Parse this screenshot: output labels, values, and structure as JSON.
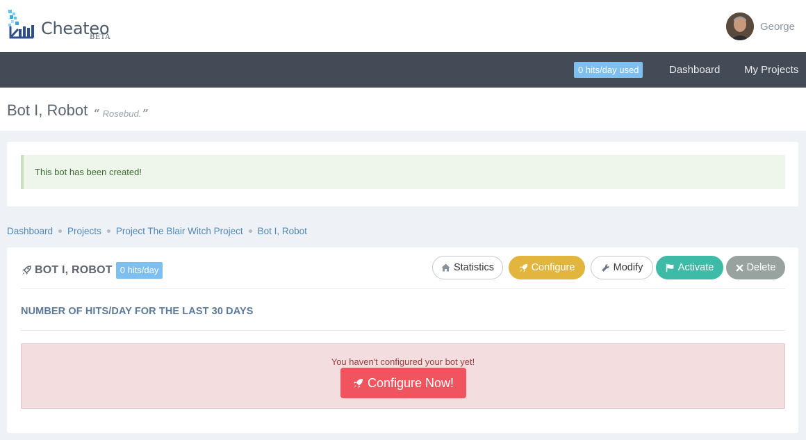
{
  "brand": {
    "name": "Cheateo",
    "tag": "BETA"
  },
  "user": {
    "name": "George"
  },
  "navbar": {
    "usage_badge": "0 hits/day used",
    "links": [
      "Dashboard",
      "My Projects"
    ]
  },
  "page": {
    "title": "Bot I, Robot",
    "quote": "Rosebud."
  },
  "alert_success": "This bot has been created!",
  "breadcrumb": [
    "Dashboard",
    "Projects",
    "Project The Blair Witch Project",
    "Bot I, Robot"
  ],
  "bot": {
    "name": "BOT I, ROBOT",
    "badge": "0 hits/day",
    "actions": {
      "statistics": "Statistics",
      "configure": "Configure",
      "modify": "Modify",
      "activate": "Activate",
      "delete": "Delete"
    },
    "section_title": "NUMBER OF HITS/DAY FOR THE LAST 30 DAYS",
    "warning": {
      "text": "You haven't configured your bot yet!",
      "button": "Configure Now!"
    }
  },
  "colors": {
    "navbar_bg": "#434b57",
    "badge_blue": "#7cbff0",
    "configure_yellow": "#e2b63e",
    "activate_teal": "#3dbba6",
    "delete_gray": "#98a3a0",
    "danger_red": "#f0555f"
  },
  "icons": {
    "logo": "chart-logo-icon",
    "rocket": "rocket-icon",
    "home": "home-icon",
    "wrench": "wrench-icon",
    "flag": "flag-icon",
    "close": "close-icon",
    "quote_open": "quote-left-icon",
    "quote_close": "quote-right-icon"
  }
}
